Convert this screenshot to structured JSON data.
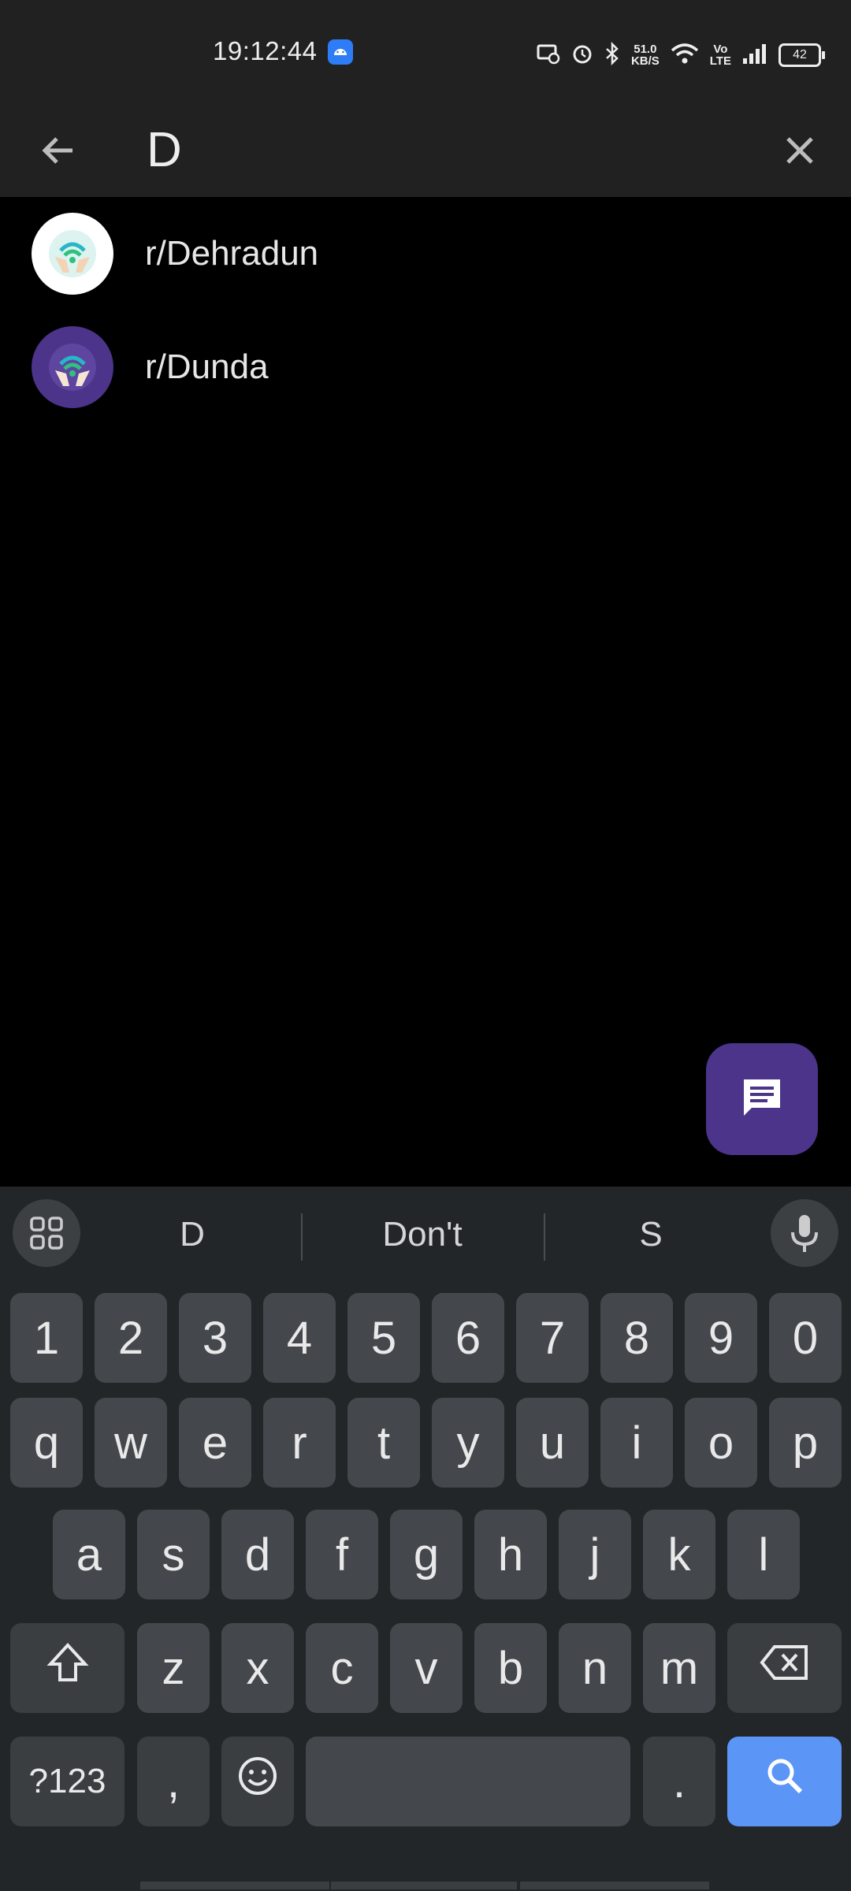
{
  "status_bar": {
    "time": "19:12:44",
    "net_speed_value": "51.0",
    "net_speed_unit": "KB/S",
    "volte_line1": "Vo",
    "volte_line2": "LTE",
    "battery": "42"
  },
  "search": {
    "query": "D"
  },
  "results": [
    {
      "label": "r/Dehradun",
      "avatar_bg": "#ffffff"
    },
    {
      "label": "r/Dunda",
      "avatar_bg": "#4b3489"
    }
  ],
  "keyboard": {
    "suggestions": [
      "D",
      "Don't",
      "S"
    ],
    "number_row": [
      "1",
      "2",
      "3",
      "4",
      "5",
      "6",
      "7",
      "8",
      "9",
      "0"
    ],
    "row1": [
      "q",
      "w",
      "e",
      "r",
      "t",
      "y",
      "u",
      "i",
      "o",
      "p"
    ],
    "row2": [
      "a",
      "s",
      "d",
      "f",
      "g",
      "h",
      "j",
      "k",
      "l"
    ],
    "row3": [
      "z",
      "x",
      "c",
      "v",
      "b",
      "n",
      "m"
    ],
    "symbols_label": "?123",
    "comma_label": ",",
    "period_label": "."
  },
  "colors": {
    "bar_bg": "#212121",
    "fab": "#4b3489",
    "accent_search_key": "#5b95f5"
  },
  "icons": {
    "back": "arrow-left-icon",
    "clear": "close-icon",
    "fab": "chat-icon",
    "grid": "apps-grid-icon",
    "mic": "microphone-icon",
    "shift": "shift-icon",
    "backspace": "backspace-icon",
    "emoji": "emoji-icon",
    "search": "search-icon"
  }
}
